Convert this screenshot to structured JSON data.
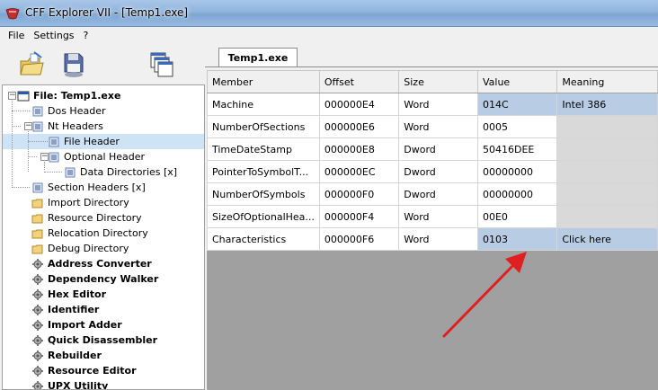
{
  "window": {
    "title": "CFF Explorer VII - [Temp1.exe]"
  },
  "menu": {
    "items": [
      "File",
      "Settings",
      "?"
    ]
  },
  "tree": {
    "root": "File: Temp1.exe",
    "dos_header": "Dos Header",
    "nt_headers": "Nt Headers",
    "file_header": "File Header",
    "optional_header": "Optional Header",
    "data_directories": "Data Directories [x]",
    "section_headers": "Section Headers [x]",
    "import_directory": "Import Directory",
    "resource_directory": "Resource Directory",
    "relocation_directory": "Relocation Directory",
    "debug_directory": "Debug Directory",
    "address_converter": "Address Converter",
    "dependency_walker": "Dependency Walker",
    "hex_editor": "Hex Editor",
    "identifier": "Identifier",
    "import_adder": "Import Adder",
    "quick_disassembler": "Quick Disassembler",
    "rebuilder": "Rebuilder",
    "resource_editor": "Resource Editor",
    "upx_utility": "UPX Utility"
  },
  "tab": {
    "label": "Temp1.exe"
  },
  "grid": {
    "headers": [
      "Member",
      "Offset",
      "Size",
      "Value",
      "Meaning"
    ],
    "rows": [
      {
        "member": "Machine",
        "offset": "000000E4",
        "size": "Word",
        "value": "014C",
        "meaning": "Intel 386"
      },
      {
        "member": "NumberOfSections",
        "offset": "000000E6",
        "size": "Word",
        "value": "0005",
        "meaning": ""
      },
      {
        "member": "TimeDateStamp",
        "offset": "000000E8",
        "size": "Dword",
        "value": "50416DEE",
        "meaning": ""
      },
      {
        "member": "PointerToSymbolT...",
        "offset": "000000EC",
        "size": "Dword",
        "value": "00000000",
        "meaning": ""
      },
      {
        "member": "NumberOfSymbols",
        "offset": "000000F0",
        "size": "Dword",
        "value": "00000000",
        "meaning": ""
      },
      {
        "member": "SizeOfOptionalHea...",
        "offset": "000000F4",
        "size": "Word",
        "value": "00E0",
        "meaning": ""
      },
      {
        "member": "Characteristics",
        "offset": "000000F6",
        "size": "Word",
        "value": "0103",
        "meaning": "Click here"
      }
    ]
  },
  "colors": {
    "highlight": "#b8cce4",
    "selection": "#cfe3f7",
    "arrow": "#e02020",
    "grid_bg": "#a0a0a0"
  }
}
